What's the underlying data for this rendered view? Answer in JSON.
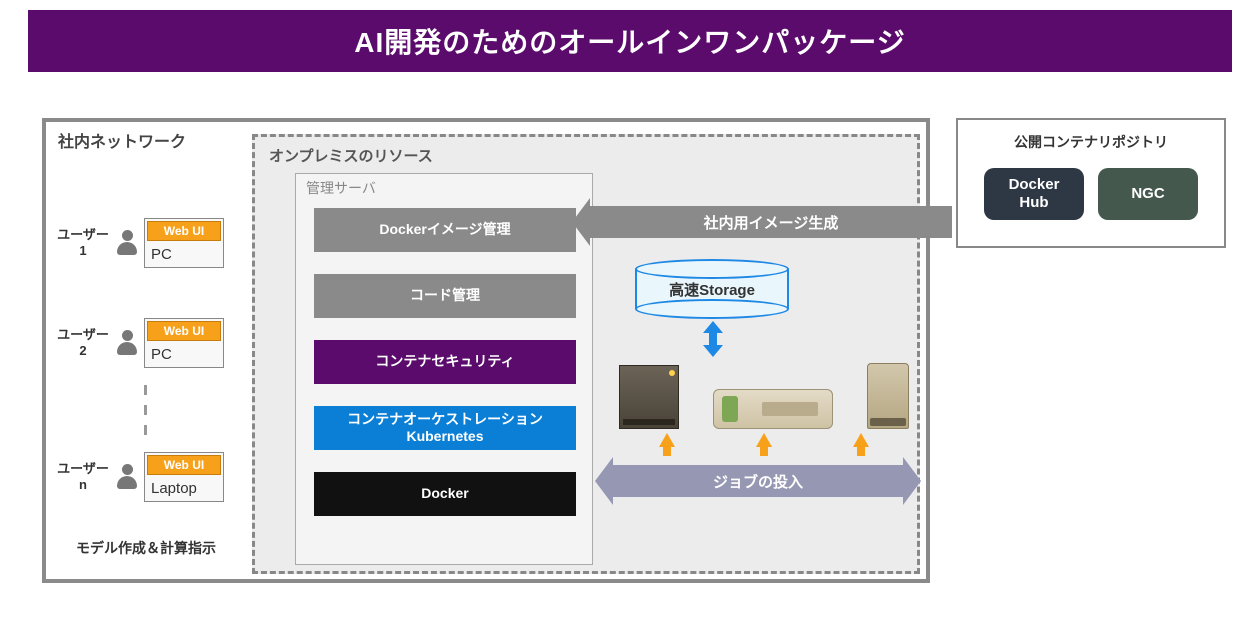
{
  "title": "AI開発のためのオールインワンパッケージ",
  "network": {
    "label": "社内ネットワーク",
    "users": [
      {
        "name": "ユーザー\n1",
        "tag": "Web UI",
        "device": "PC"
      },
      {
        "name": "ユーザー\n2",
        "tag": "Web UI",
        "device": "PC"
      },
      {
        "name": "ユーザー\nn",
        "tag": "Web UI",
        "device": "Laptop"
      }
    ],
    "caption": "モデル作成＆計算指示"
  },
  "onprem": {
    "label": "オンプレミスのリソース",
    "mgmt": {
      "label": "管理サーバ",
      "items": [
        {
          "text": "Dockerイメージ管理",
          "class": "bg-gray"
        },
        {
          "text": "コード管理",
          "class": "bg-gray"
        },
        {
          "text": "コンテナセキュリティ",
          "class": "bg-purple"
        },
        {
          "text": "コンテナオーケストレーション\nKubernetes",
          "class": "bg-blue"
        },
        {
          "text": "Docker",
          "class": "bg-black"
        }
      ]
    },
    "storage_label": "高速Storage"
  },
  "arrows": {
    "image_gen": "社内用イメージ生成",
    "job_submit": "ジョブの投入"
  },
  "repo": {
    "title": "公開コンテナリポジトリ",
    "docker": "Docker\nHub",
    "ngc": "NGC"
  }
}
